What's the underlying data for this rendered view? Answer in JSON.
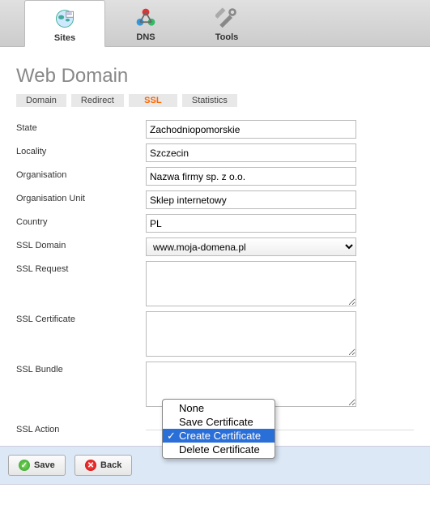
{
  "tabbar": {
    "sites": "Sites",
    "dns": "DNS",
    "tools": "Tools"
  },
  "page_title": "Web Domain",
  "subtabs": {
    "domain": "Domain",
    "redirect": "Redirect",
    "ssl": "SSL",
    "statistics": "Statistics"
  },
  "labels": {
    "state": "State",
    "locality": "Locality",
    "organisation": "Organisation",
    "organisation_unit": "Organisation Unit",
    "country": "Country",
    "ssl_domain": "SSL Domain",
    "ssl_request": "SSL Request",
    "ssl_certificate": "SSL Certificate",
    "ssl_bundle": "SSL Bundle",
    "ssl_action": "SSL Action"
  },
  "values": {
    "state": "Zachodniopomorskie",
    "locality": "Szczecin",
    "organisation": "Nazwa firmy sp. z o.o.",
    "organisation_unit": "Sklep internetowy",
    "country": "PL",
    "ssl_domain": "www.moja-domena.pl",
    "ssl_request": "",
    "ssl_certificate": "",
    "ssl_bundle": ""
  },
  "ssl_action_options": {
    "none": "None",
    "save": "Save Certificate",
    "create": "Create Certificate",
    "delete": "Delete Certificate"
  },
  "buttons": {
    "save": "Save",
    "back": "Back"
  }
}
